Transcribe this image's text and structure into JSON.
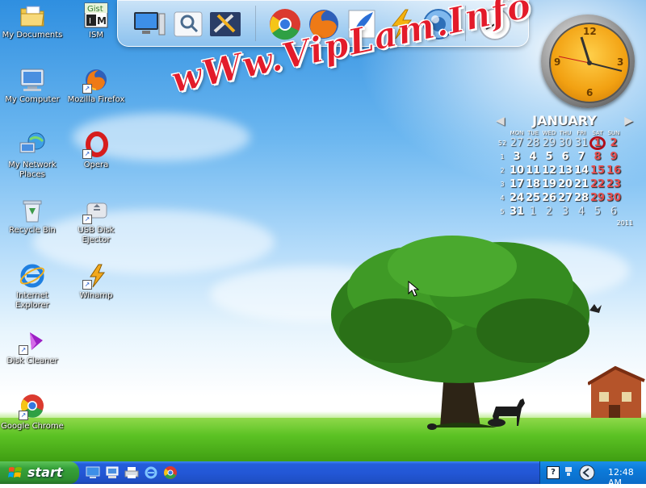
{
  "desktop": {
    "icons": [
      {
        "label": "My Documents",
        "icon": "folder-documents-icon"
      },
      {
        "label": "My Computer",
        "icon": "computer-icon"
      },
      {
        "label": "My Network Places",
        "icon": "network-icon"
      },
      {
        "label": "Recycle Bin",
        "icon": "recycle-bin-icon"
      },
      {
        "label": "Internet Explorer",
        "icon": "ie-icon"
      },
      {
        "label": "Disk Cleaner",
        "icon": "disk-cleaner-icon"
      },
      {
        "label": "Google Chrome",
        "icon": "chrome-icon"
      },
      {
        "label": "ISM",
        "icon": "ism-icon"
      },
      {
        "label": "Mozilla Firefox",
        "icon": "firefox-icon"
      },
      {
        "label": "Opera",
        "icon": "opera-icon"
      },
      {
        "label": "USB Disk Ejector",
        "icon": "usb-ejector-icon"
      },
      {
        "label": "Winamp",
        "icon": "winamp-icon"
      }
    ],
    "watermark": "wWw.VipLam.Info"
  },
  "dock": {
    "items": [
      "monitor-icon",
      "search-icon",
      "tools-icon",
      "chrome-icon",
      "firefox-icon",
      "feather-icon",
      "lightning-icon",
      "blue-orb-icon",
      "clock-icon"
    ]
  },
  "clock_widget": {
    "numbers": [
      "12",
      "3",
      "6",
      "9"
    ]
  },
  "calendar": {
    "month": "JANUARY",
    "year": "2011",
    "prev": "◀",
    "next": "▶",
    "days_of_week": [
      "MON",
      "TUE",
      "WED",
      "THU",
      "FRI",
      "SAT",
      "SUN"
    ],
    "weeks": [
      {
        "wk": "52",
        "days": [
          "27",
          "28",
          "29",
          "30",
          "31",
          "1",
          "2"
        ]
      },
      {
        "wk": "1",
        "days": [
          "3",
          "4",
          "5",
          "6",
          "7",
          "8",
          "9"
        ]
      },
      {
        "wk": "2",
        "days": [
          "10",
          "11",
          "12",
          "13",
          "14",
          "15",
          "16"
        ]
      },
      {
        "wk": "3",
        "days": [
          "17",
          "18",
          "19",
          "20",
          "21",
          "22",
          "23"
        ]
      },
      {
        "wk": "4",
        "days": [
          "24",
          "25",
          "26",
          "27",
          "28",
          "29",
          "30"
        ]
      },
      {
        "wk": "5",
        "days": [
          "31",
          "1",
          "2",
          "3",
          "4",
          "5",
          "6"
        ]
      }
    ],
    "today": "1"
  },
  "taskbar": {
    "start_label": "start",
    "quick_launch": [
      "desktop-icon",
      "my-computer-icon",
      "printer-icon",
      "ie-icon",
      "chrome-icon"
    ],
    "tray": {
      "time": "12:48 AM",
      "icons": [
        "help-icon",
        "network-status-icon",
        "volume-icon"
      ]
    }
  },
  "colors": {
    "taskbar": "#245edb",
    "start": "#37a33a",
    "tray": "#0c7ad9",
    "watermark": "#e31b2a"
  }
}
